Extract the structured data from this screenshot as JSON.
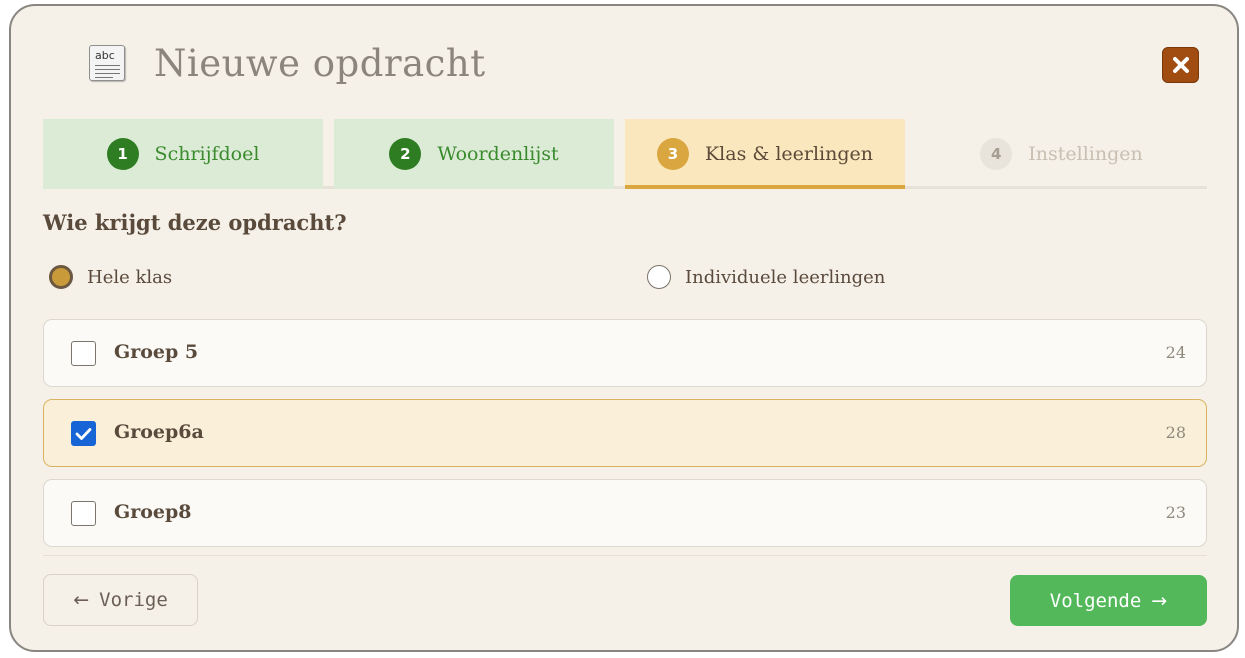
{
  "header": {
    "title": "Nieuwe opdracht",
    "app_icon_text": "abc"
  },
  "steps": [
    {
      "number": "1",
      "label": "Schrijfdoel",
      "state": "done"
    },
    {
      "number": "2",
      "label": "Woordenlijst",
      "state": "done"
    },
    {
      "number": "3",
      "label": "Klas & leerlingen",
      "state": "active"
    },
    {
      "number": "4",
      "label": "Instellingen",
      "state": "todo"
    }
  ],
  "question": "Wie krijgt deze opdracht?",
  "recipient_options": [
    {
      "label": "Hele klas",
      "selected": true
    },
    {
      "label": "Individuele leerlingen",
      "selected": false
    }
  ],
  "groups": [
    {
      "name": "Groep 5",
      "count": "24",
      "checked": false
    },
    {
      "name": "Groep6a",
      "count": "28",
      "checked": true
    },
    {
      "name": "Groep8",
      "count": "23",
      "checked": false
    }
  ],
  "footer": {
    "prev_arrow": "←",
    "prev_label": "Vorige",
    "next_label": "Volgende",
    "next_arrow": "→"
  },
  "colors": {
    "done_step_bg": "#dcebd6",
    "done_step_number": "#2f7d22",
    "active_step_bg": "#fbe7bd",
    "active_accent": "#d9a640",
    "close_button": "#a14c10",
    "next_button": "#52b85a",
    "checkbox_checked": "#1664d6"
  },
  "icons": {
    "app": "document-abc-icon",
    "close": "close-icon",
    "checkbox_check": "check-icon"
  }
}
